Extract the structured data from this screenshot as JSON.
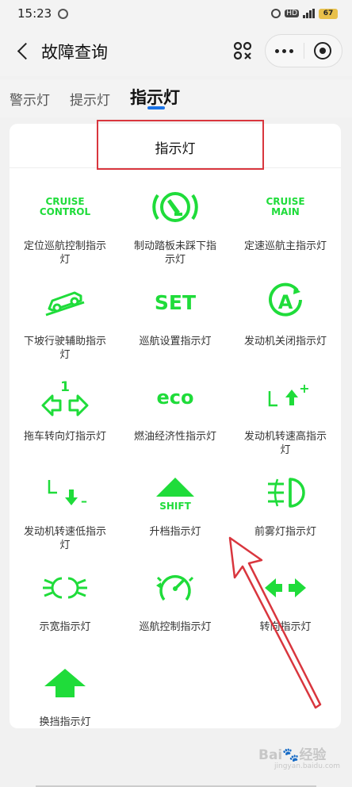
{
  "status": {
    "time": "15:23",
    "battery": "67",
    "network": "HD"
  },
  "header": {
    "title": "故障查询"
  },
  "tabs": [
    {
      "label": "警示灯"
    },
    {
      "label": "提示灯"
    },
    {
      "label": "指示灯",
      "active": true
    }
  ],
  "card": {
    "title": "指示灯",
    "items": [
      {
        "label": "定位巡航控制指示灯",
        "icon": "cruise-control-text",
        "icon_text": "CRUISE\nCONTROL"
      },
      {
        "label": "制动踏板未踩下指示灯",
        "icon": "brake-pedal-icon"
      },
      {
        "label": "定速巡航主指示灯",
        "icon": "cruise-main-text",
        "icon_text": "CRUISE\nMAIN"
      },
      {
        "label": "下坡行驶辅助指示灯",
        "icon": "hill-descent-icon"
      },
      {
        "label": "巡航设置指示灯",
        "icon": "set-text",
        "icon_text": "SET"
      },
      {
        "label": "发动机关闭指示灯",
        "icon": "auto-stop-icon",
        "icon_text": "A"
      },
      {
        "label": "拖车转向灯指示灯",
        "icon": "trailer-turn-icon",
        "icon_text": "1"
      },
      {
        "label": "燃油经济性指示灯",
        "icon": "eco-text",
        "icon_text": "eco"
      },
      {
        "label": "发动机转速高指示灯",
        "icon": "shift-up-icon",
        "icon_text": "+"
      },
      {
        "label": "发动机转速低指示灯",
        "icon": "shift-down-icon",
        "icon_text": "–"
      },
      {
        "label": "升档指示灯",
        "icon": "shift-icon",
        "icon_text": "SHIFT"
      },
      {
        "label": "前雾灯指示灯",
        "icon": "front-fog-icon"
      },
      {
        "label": "示宽指示灯",
        "icon": "side-light-icon"
      },
      {
        "label": "巡航控制指示灯",
        "icon": "cruise-speedo-icon"
      },
      {
        "label": "转向指示灯",
        "icon": "turn-signal-icon"
      },
      {
        "label": "换挡指示灯",
        "icon": "gear-shift-icon"
      }
    ]
  },
  "watermark": {
    "text": "Bai",
    "text2": "经验",
    "sub": "jingyan.baidu.com"
  },
  "colors": {
    "icon_green": "#1fdc3a",
    "accent": "#1a73e8",
    "annotation_red": "#d9363e"
  }
}
